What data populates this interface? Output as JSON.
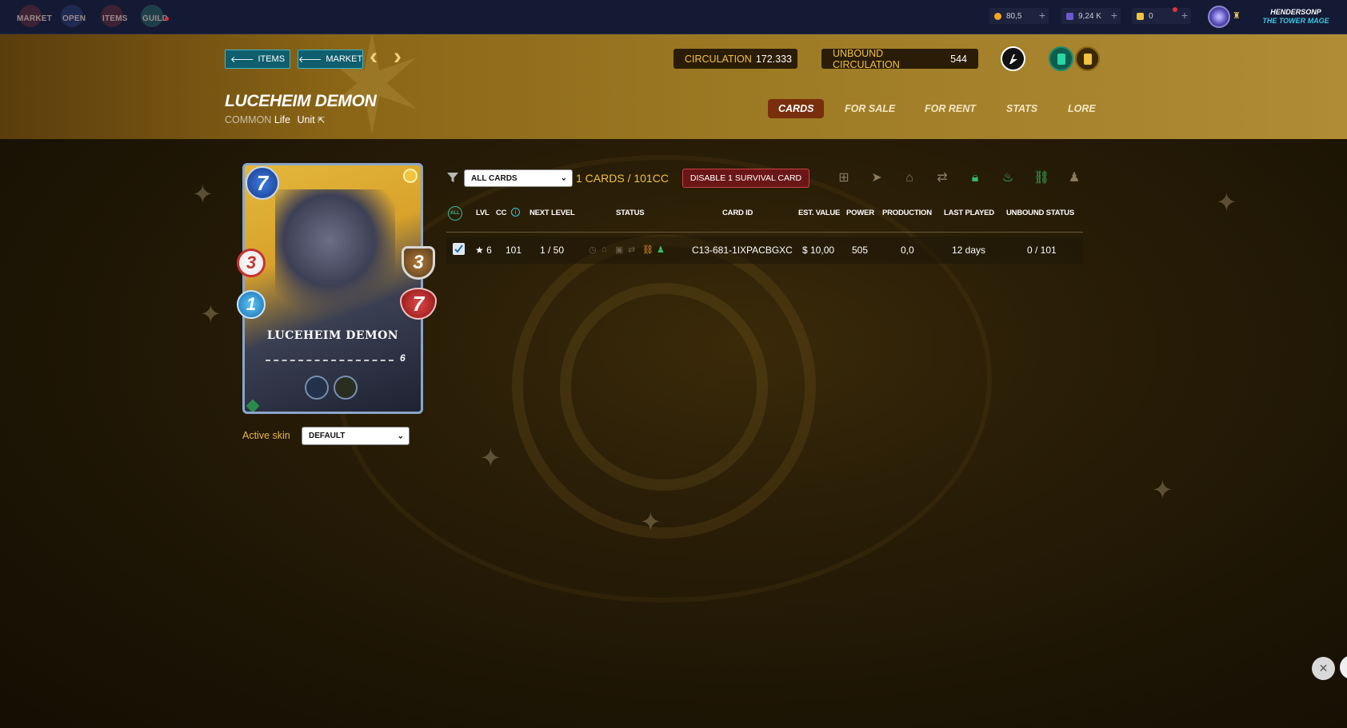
{
  "topnav": {
    "items": [
      {
        "label": "MARKET"
      },
      {
        "label": "OPEN"
      },
      {
        "label": "ITEMS"
      },
      {
        "label": "GUILD"
      }
    ],
    "resources": [
      {
        "value": "80,5",
        "icon": "coin-icon",
        "color": "#f5a623"
      },
      {
        "value": "9,24 K",
        "icon": "gem-icon",
        "color": "#6a5acd"
      },
      {
        "value": "0",
        "icon": "ticket-icon",
        "color": "#f0c340"
      }
    ],
    "user": {
      "name": "HENDERSONP",
      "rank": "THE TOWER MAGE"
    }
  },
  "header": {
    "back_items": "ITEMS",
    "back_market": "MARKET",
    "circulation_label": "CIRCULATION",
    "circulation_value": "172.333",
    "unbound_label": "UNBOUND CIRCULATION",
    "unbound_value": "544",
    "title": "LUCEHEIM DEMON",
    "rarity": "COMMON",
    "element": "Life",
    "type": "Unit",
    "tabs": [
      {
        "label": "CARDS",
        "active": true
      },
      {
        "label": "FOR SALE"
      },
      {
        "label": "FOR RENT"
      },
      {
        "label": "STATS"
      },
      {
        "label": "LORE"
      }
    ]
  },
  "card": {
    "name": "LUCEHEIM DEMON",
    "mana": "7",
    "attack": "3",
    "speed": "1",
    "armor": "3",
    "health": "7",
    "level": "6"
  },
  "skin": {
    "label": "Active skin",
    "value": "DEFAULT"
  },
  "filter": {
    "selected": "ALL CARDS",
    "count": "1 CARDS / 101CC",
    "disable_button": "DISABLE 1 SURVIVAL CARD"
  },
  "table": {
    "all_badge": "ALL",
    "headers": {
      "lvl": "LVL",
      "cc": "CC",
      "next_level": "NEXT LEVEL",
      "status": "STATUS",
      "card_id": "CARD ID",
      "est_value": "EST. VALUE",
      "power": "POWER",
      "production": "PRODUCTION",
      "last_played": "LAST PLAYED",
      "unbound_status": "UNBOUND STATUS"
    },
    "rows": [
      {
        "lvl": "★ 6",
        "cc": "101",
        "next_level": "1 / 50",
        "card_id": "C13-681-1IXPACBGXC",
        "est_value": "$ 10,00",
        "power": "505",
        "production": "0,0",
        "last_played": "12 days",
        "unbound_status": "0 / 101"
      }
    ]
  },
  "colors": {
    "accent_gold": "#f0c340",
    "teal_button": "#0e5e6e",
    "danger_button": "#6a1616",
    "active_tab": "#7a2e0e"
  }
}
